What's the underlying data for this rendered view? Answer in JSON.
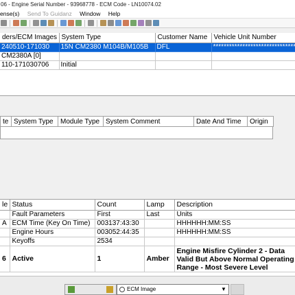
{
  "window": {
    "title": "06 - Engine Serial Number - 93968778 - ECM Code - LN10074.02"
  },
  "menu": {
    "items": [
      {
        "label": "ense(s)",
        "enabled": true
      },
      {
        "label": "Send To Guidanz",
        "enabled": false
      },
      {
        "label": "Window",
        "enabled": true
      },
      {
        "label": "Help",
        "enabled": true
      }
    ]
  },
  "toolbar_icons": [
    "bitmap-icon",
    "separator",
    "open-icon",
    "save-icon",
    "separator",
    "back-icon",
    "connect-icon",
    "print-icon",
    "separator",
    "copy-icon",
    "paste-icon",
    "filter-icon",
    "separator",
    "calendar-icon",
    "separator",
    "record-icon",
    "play-icon",
    "step-icon",
    "pause-icon",
    "stop-icon",
    "table-icon",
    "chart-icon",
    "report-icon"
  ],
  "top_grid": {
    "headers": [
      "ders/ECM Images",
      "System Type",
      "Customer Name",
      "Vehicle Unit Number"
    ],
    "rows": [
      {
        "cells": [
          "240510-171030",
          "15N CM2380 M104B/M105B",
          "DFL",
          "*********************************"
        ],
        "selected": true
      },
      {
        "cells": [
          "CM2380A [0]",
          "",
          "",
          ""
        ],
        "selected": false
      },
      {
        "cells": [
          "110-171030706",
          "Initial",
          "",
          ""
        ],
        "selected": false
      }
    ]
  },
  "mid_grid": {
    "headers": [
      "te",
      "System Type",
      "Module Type",
      "System Comment",
      "Date And Time",
      "Origin"
    ]
  },
  "fault_grid": {
    "headers": [
      "le",
      "Status",
      "Count",
      "Lamp",
      "Description"
    ],
    "rows": [
      {
        "code": "",
        "status": "Fault Parameters",
        "count": "First",
        "lamp": "Last",
        "desc": "Units",
        "big": false
      },
      {
        "code": "A",
        "status": "ECM Time (Key On Time)",
        "count": "003137:43:30",
        "lamp": "",
        "desc": "HHHHHH:MM:SS",
        "big": false
      },
      {
        "code": "",
        "status": "Engine Hours",
        "count": "003052:44:35",
        "lamp": "",
        "desc": "HHHHHH:MM:SS",
        "big": false
      },
      {
        "code": "",
        "status": "Keyoffs",
        "count": "2534",
        "lamp": "",
        "desc": "",
        "big": false
      },
      {
        "code": "6",
        "status": "Active",
        "count": "1",
        "lamp": "Amber",
        "desc": "Engine Misfire Cylinder 2 - Data Valid But Above Normal Operating Range - Most Severe Level",
        "big": true
      }
    ]
  },
  "bottom_bar": {
    "select_value": "ECM Image"
  }
}
